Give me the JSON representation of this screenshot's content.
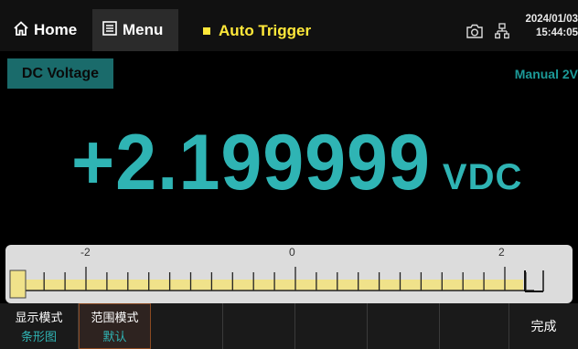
{
  "topbar": {
    "home_label": "Home",
    "menu_label": "Menu",
    "trigger_label": "Auto Trigger",
    "date": "2024/01/03",
    "time": "15:44:05",
    "icons": [
      "home-icon",
      "menu-icon",
      "camera-icon",
      "network-icon"
    ]
  },
  "measurement": {
    "function": "DC Voltage",
    "range": "Manual 2V",
    "value": "+2.199999",
    "unit": "VDC"
  },
  "bargraph": {
    "tick_labels": [
      "-2",
      "0",
      "2"
    ],
    "min": -2,
    "max": 2,
    "reading": 2.199999,
    "fill_color": "#f0e28a"
  },
  "softkeys": [
    {
      "label": "显示模式",
      "sub": "条形图"
    },
    {
      "label": "范围模式",
      "sub": "默认"
    },
    {
      "label": "",
      "sub": ""
    },
    {
      "label": "",
      "sub": ""
    },
    {
      "label": "",
      "sub": ""
    },
    {
      "label": "",
      "sub": ""
    },
    {
      "label": "",
      "sub": ""
    },
    {
      "label": "完成",
      "sub": ""
    }
  ],
  "colors": {
    "accent": "#2fb4b4",
    "trigger": "#ffe83a",
    "function_bg": "#1a6b6b"
  }
}
